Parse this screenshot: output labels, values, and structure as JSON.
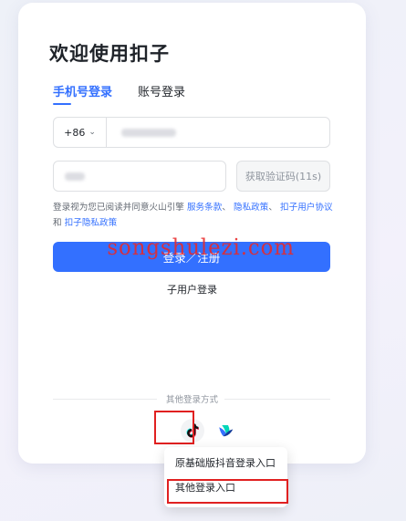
{
  "title": "欢迎使用扣子",
  "tabs": {
    "phone": "手机号登录",
    "account": "账号登录"
  },
  "phone": {
    "country_code": "+86"
  },
  "code": {
    "button": "获取验证码(11s)"
  },
  "agreement": {
    "prefix": "登录视为您已阅读并同意火山引擎",
    "link1": "服务条款",
    "sep1": "、",
    "link2": "隐私政策",
    "sep2": "、",
    "link3": "扣子用户协议",
    "and": "和",
    "link4": "扣子隐私政策"
  },
  "login_button": "登录／注册",
  "watermark": "songshulezi.com",
  "sub_user_login": "子用户登录",
  "other_methods": "其他登录方式",
  "dropdown": {
    "item1": "原基础版抖音登录入口",
    "item2": "其他登录入口"
  },
  "colors": {
    "accent": "#3370ff",
    "highlight": "#e02020"
  }
}
